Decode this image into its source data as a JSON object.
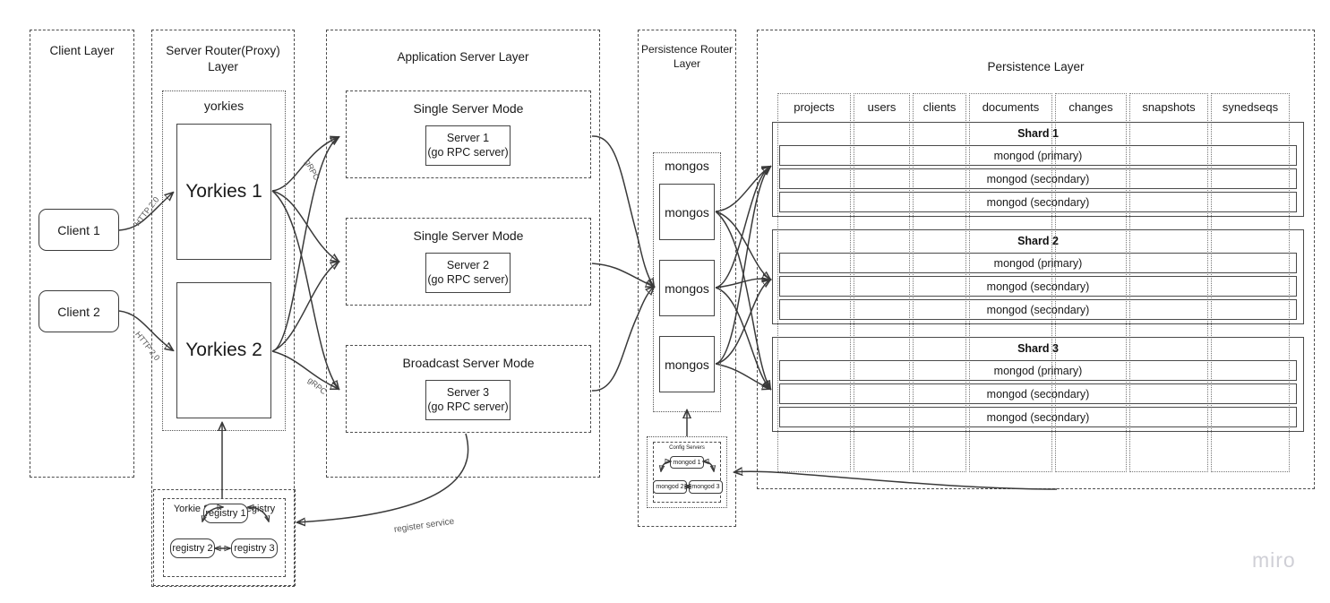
{
  "diagram": {
    "watermark": "miro"
  },
  "layers": [
    {
      "id": "client",
      "title": "Client Layer"
    },
    {
      "id": "server_router",
      "title": "Server Router(Proxy)\nLayer"
    },
    {
      "id": "application",
      "title": "Application Server Layer"
    },
    {
      "id": "persistence_router",
      "title": "Persistence Router\nLayer"
    },
    {
      "id": "persistence",
      "title": "Persistence Layer"
    }
  ],
  "client_layer": {
    "clients": [
      {
        "label": "Client 1"
      },
      {
        "label": "Client 2"
      }
    ]
  },
  "server_router_layer": {
    "group_label": "yorkies",
    "nodes": [
      {
        "label": "Yorkies 1"
      },
      {
        "label": "Yorkies 2"
      }
    ],
    "registry": {
      "title": "Yorkie Service Registry",
      "nodes": [
        {
          "label": "registry 1"
        },
        {
          "label": "registry 2"
        },
        {
          "label": "registry 3"
        }
      ]
    }
  },
  "application_layer": {
    "modes": [
      {
        "mode": "Single Server Mode",
        "server": "Server 1",
        "detail": "(go RPC server)"
      },
      {
        "mode": "Single Server Mode",
        "server": "Server 2",
        "detail": "(go RPC server)"
      },
      {
        "mode": "Broadcast Server Mode",
        "server": "Server 3",
        "detail": "(go RPC server)"
      }
    ]
  },
  "persistence_router_layer": {
    "group_label": "mongos",
    "nodes": [
      {
        "label": "mongos"
      },
      {
        "label": "mongos"
      },
      {
        "label": "mongos"
      }
    ],
    "config_servers": {
      "title": "Config Servers",
      "nodes": [
        {
          "label": "mongod 1"
        },
        {
          "label": "mongod 2"
        },
        {
          "label": "mongod 3"
        }
      ]
    }
  },
  "persistence_layer": {
    "collections": [
      "projects",
      "users",
      "clients",
      "documents",
      "changes",
      "snapshots",
      "synedseqs"
    ],
    "shards": [
      {
        "title": "Shard 1",
        "members": [
          "mongod (primary)",
          "mongod (secondary)",
          "mongod (secondary)"
        ]
      },
      {
        "title": "Shard 2",
        "members": [
          "mongod (primary)",
          "mongod (secondary)",
          "mongod (secondary)"
        ]
      },
      {
        "title": "Shard 3",
        "members": [
          "mongod (primary)",
          "mongod (secondary)",
          "mongod (secondary)"
        ]
      }
    ]
  },
  "edge_labels": {
    "http_1": "HTTP 2.0",
    "http_2": "HTTP 2.0",
    "grpc_1": "gRPC",
    "grpc_2": "gRPC",
    "register_service": "register service"
  }
}
